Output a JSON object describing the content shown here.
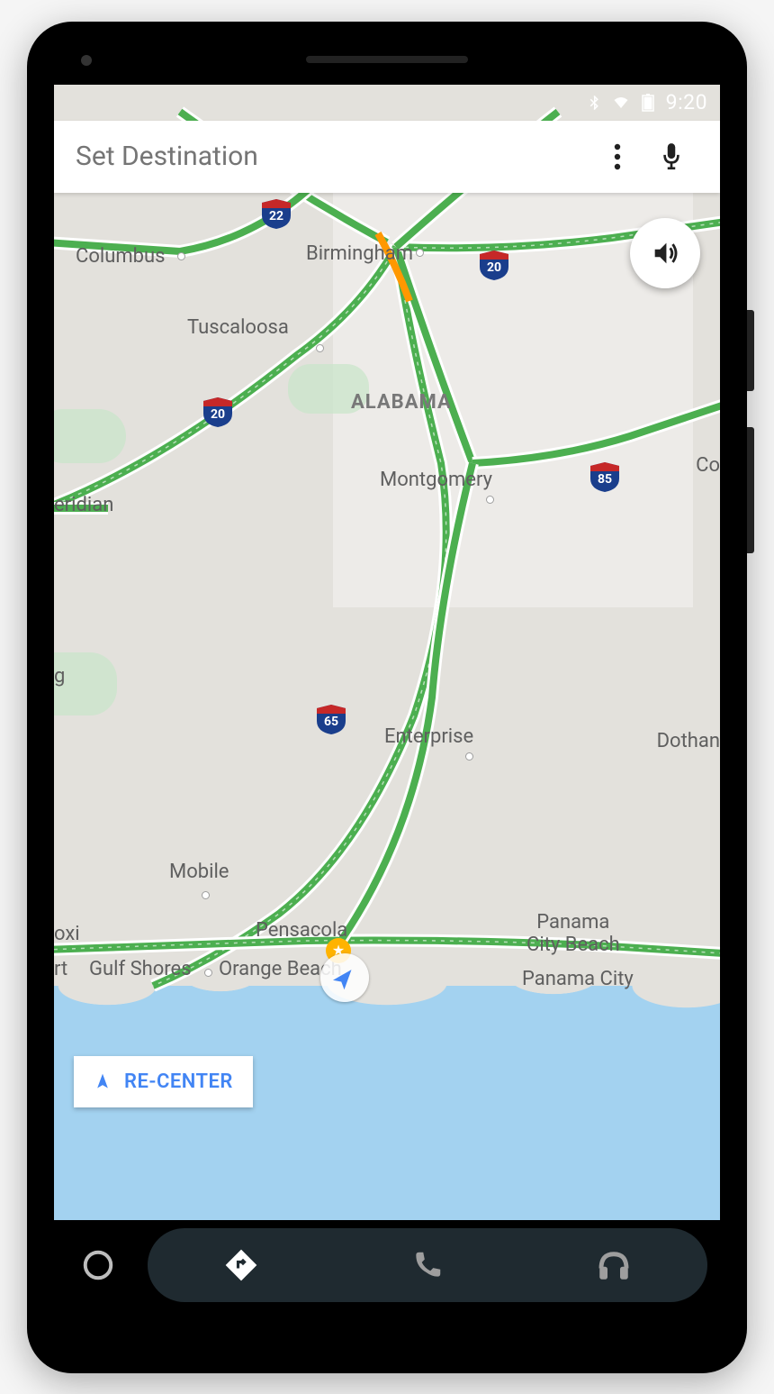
{
  "status": {
    "time": "9:20"
  },
  "search": {
    "placeholder": "Set Destination"
  },
  "recenter": {
    "label": "RE-CENTER"
  },
  "state_label": "ALABAMA",
  "cities": {
    "columbus": "Columbus",
    "birmingham": "Birmingham",
    "tuscaloosa": "Tuscaloosa",
    "eridian": "eridian",
    "montgomery": "Montgomery",
    "co": "Co",
    "g": "g",
    "enterprise": "Enterprise",
    "dothan": "Dothan",
    "mobile": "Mobile",
    "oxi": "oxi",
    "rt": "rt",
    "pensacola": "Pensacola",
    "gulf_shores": "Gulf Shores",
    "orange_beach": "Orange Beach",
    "panama_city_beach": "Panama\nCity Beach",
    "panama_city": "Panama City"
  },
  "shields": {
    "i22": "22",
    "i20_a": "20",
    "i20_b": "20",
    "i85": "85",
    "i65": "65"
  }
}
